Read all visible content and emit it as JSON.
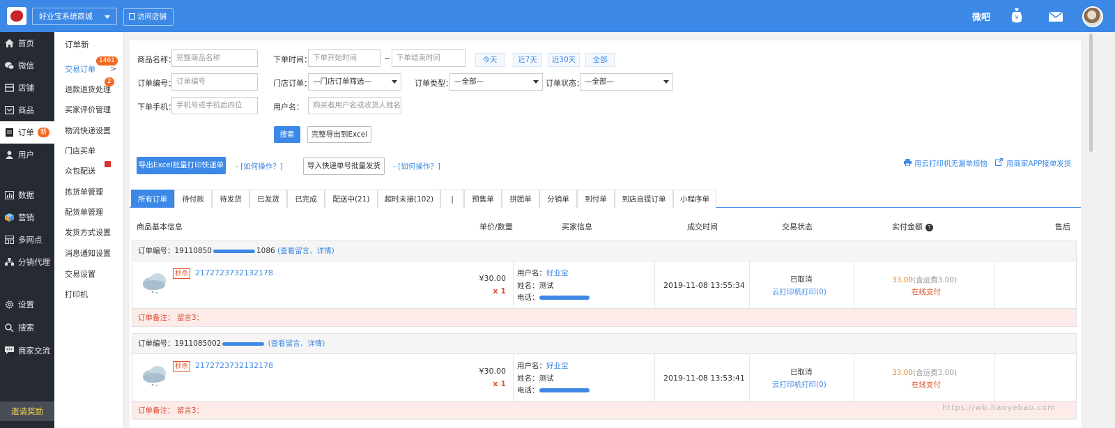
{
  "topbar": {
    "shop_name": "好业宝系统商城",
    "visit_store": "访问店铺",
    "weiba": "微吧",
    "icons": [
      "money-bag-icon",
      "mail-icon",
      "avatar"
    ]
  },
  "sidebar": {
    "items": [
      {
        "label": "首页",
        "icon": "home-icon"
      },
      {
        "label": "微信",
        "icon": "wechat-icon"
      },
      {
        "label": "店铺",
        "icon": "store-icon"
      },
      {
        "label": "商品",
        "icon": "goods-icon"
      },
      {
        "label": "订单",
        "icon": "order-icon",
        "badge": "新"
      },
      {
        "label": "用户",
        "icon": "user-icon"
      },
      {
        "label": "数据",
        "icon": "chart-icon"
      },
      {
        "label": "营销",
        "icon": "gift-icon"
      },
      {
        "label": "多网点",
        "icon": "branches-icon"
      },
      {
        "label": "分销代理",
        "icon": "agent-icon"
      },
      {
        "label": "设置",
        "icon": "gear-icon"
      },
      {
        "label": "搜索",
        "icon": "search-icon"
      },
      {
        "label": "商家交流",
        "icon": "chat-icon"
      }
    ],
    "invite": "邀请奖励"
  },
  "subnav": {
    "title": "订单新",
    "items": [
      {
        "label": "交易订单",
        "badge": "1461"
      },
      {
        "label": "退款退货处理",
        "badge": "2"
      },
      {
        "label": "买家评价管理"
      },
      {
        "label": "物流快递设置"
      },
      {
        "label": "门店买单"
      },
      {
        "label": "众包配送"
      },
      {
        "label": "拣货单管理"
      },
      {
        "label": "配货单管理"
      },
      {
        "label": "发货方式设置"
      },
      {
        "label": "消息通知设置"
      },
      {
        "label": "交易设置"
      },
      {
        "label": "打印机"
      }
    ]
  },
  "filters": {
    "product_name_label": "商品名称：",
    "product_name_placeholder": "完整商品名称",
    "order_time_label": "下单时间：",
    "start_placeholder": "下单开始时间",
    "tilde": "~",
    "end_placeholder": "下单结束时间",
    "quick": [
      "今天",
      "近7天",
      "近30天",
      "全部"
    ],
    "order_no_label": "订单编号：",
    "order_no_placeholder": "订单编号",
    "store_order_label": "门店订单：",
    "store_order_value": "—门店订单筛选—",
    "order_type_label": "订单类型：",
    "order_type_value": "—全部—",
    "order_status_label": "订单状态：",
    "order_status_value": "—全部—",
    "phone_label": "下单手机：",
    "phone_placeholder": "手机号或手机后四位",
    "username_label": "用户名：",
    "username_placeholder": "购买者用户名或收货人姓名",
    "search": "搜索",
    "export_excel": "完整导出到Excel"
  },
  "actions": {
    "export_print": "导出Excel批量打印快递单",
    "how1": "- [如何操作？]",
    "import_ship": "导入快递单号批量发货",
    "how2": "- [如何操作？]",
    "cloud_print": "用云打印机无漏单烦恼",
    "app_order": "用商家APP接单发货"
  },
  "tabs": [
    "所有订单",
    "待付款",
    "待发货",
    "已发货",
    "已完成",
    "配送中(21)",
    "超时未接(102)",
    "|",
    "预售单",
    "拼团单",
    "分销单",
    "到付单",
    "到店自提订单",
    "小程序单"
  ],
  "table_headers": {
    "goods": "商品基本信息",
    "price_qty": "单价/数量",
    "buyer": "买家信息",
    "time": "成交时间",
    "status": "交易状态",
    "amount": "实付金额",
    "after_sale": "售后"
  },
  "orders": [
    {
      "no_label": "订单编号：",
      "no_prefix": "19110850",
      "no_suffix": "1086",
      "links": "(查看留言、详情)",
      "tag": "秒杀",
      "goods_id": "2172723732132178",
      "price": "¥30.00",
      "qty": "x 1",
      "user_label": "用户名：",
      "user": "好业宝",
      "name_label": "姓名：",
      "name": "测试",
      "phone_label": "电话：",
      "time": "2019-11-08 13:55:34",
      "status": "已取消",
      "cloud_print": "云打印机打印(0)",
      "amount": "33.00",
      "shipping": "(含运费3.00)",
      "pay": "在线支付",
      "note_label": "订单备注：",
      "note": "留言3："
    },
    {
      "no_label": "订单编号：",
      "no_prefix": "1911085002",
      "no_suffix": "",
      "links": "(查看留言、详情)",
      "tag": "秒杀",
      "goods_id": "2172723732132178",
      "price": "¥30.00",
      "qty": "x 1",
      "user_label": "用户名：",
      "user": "好业宝",
      "name_label": "姓名：",
      "name": "测试",
      "phone_label": "电话：",
      "time": "2019-11-08 13:53:41",
      "status": "已取消",
      "cloud_print": "云打印机打印(0)",
      "amount": "33.00",
      "shipping": "(含运费3.00)",
      "pay": "在线支付",
      "note_label": "订单备注：",
      "note": "留言3："
    }
  ],
  "watermark": "https://wb.haoyebao.com"
}
